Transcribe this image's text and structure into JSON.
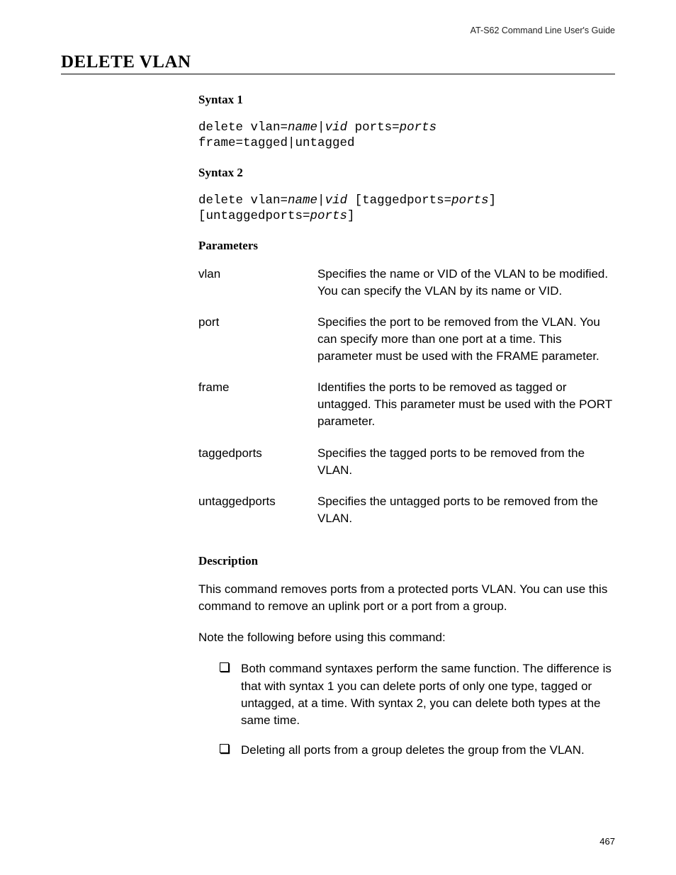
{
  "header": {
    "guide_title": "AT-S62 Command Line User's Guide"
  },
  "title": "DELETE VLAN",
  "syntax1": {
    "heading": "Syntax 1",
    "code_pre1": "delete vlan=",
    "code_it1": "name",
    "code_pipe1": "|",
    "code_it2": "vid",
    "code_mid1": " ports=",
    "code_it3": "ports",
    "code_line2": "frame=tagged|untagged"
  },
  "syntax2": {
    "heading": "Syntax 2",
    "code_pre1": "delete vlan=",
    "code_it1": "name",
    "code_pipe1": "|",
    "code_it2": "vid",
    "code_mid1": " [taggedports=",
    "code_it3": "ports",
    "code_close1": "]",
    "code_line2_pre": "[untaggedports=",
    "code_line2_it": "ports",
    "code_line2_close": "]"
  },
  "parameters": {
    "heading": "Parameters",
    "rows": [
      {
        "name": "vlan",
        "desc": "Specifies the name or VID of the VLAN to be modified. You can specify the VLAN by its name or VID."
      },
      {
        "name": "port",
        "desc": "Specifies the port to be removed from the VLAN. You can specify more than one port at a time. This parameter must be used with the FRAME parameter."
      },
      {
        "name": "frame",
        "desc": "Identifies the ports to be removed as tagged or untagged. This parameter must be used with the PORT parameter."
      },
      {
        "name": "taggedports",
        "desc": "Specifies the tagged ports to be removed from the VLAN."
      },
      {
        "name": "untaggedports",
        "desc": "Specifies the untagged ports to be removed from the VLAN."
      }
    ]
  },
  "description": {
    "heading": "Description",
    "para1": "This command removes ports from a protected ports VLAN. You can use this command to remove an uplink port or a port from a group.",
    "para2": "Note the following before using this command:",
    "bullets": [
      "Both command syntaxes perform the same function. The difference is that with syntax 1 you can delete ports of only one type, tagged or untagged, at a time. With syntax 2, you can delete both types at the same time.",
      "Deleting all ports from a group deletes the group from the VLAN."
    ]
  },
  "page_number": "467"
}
